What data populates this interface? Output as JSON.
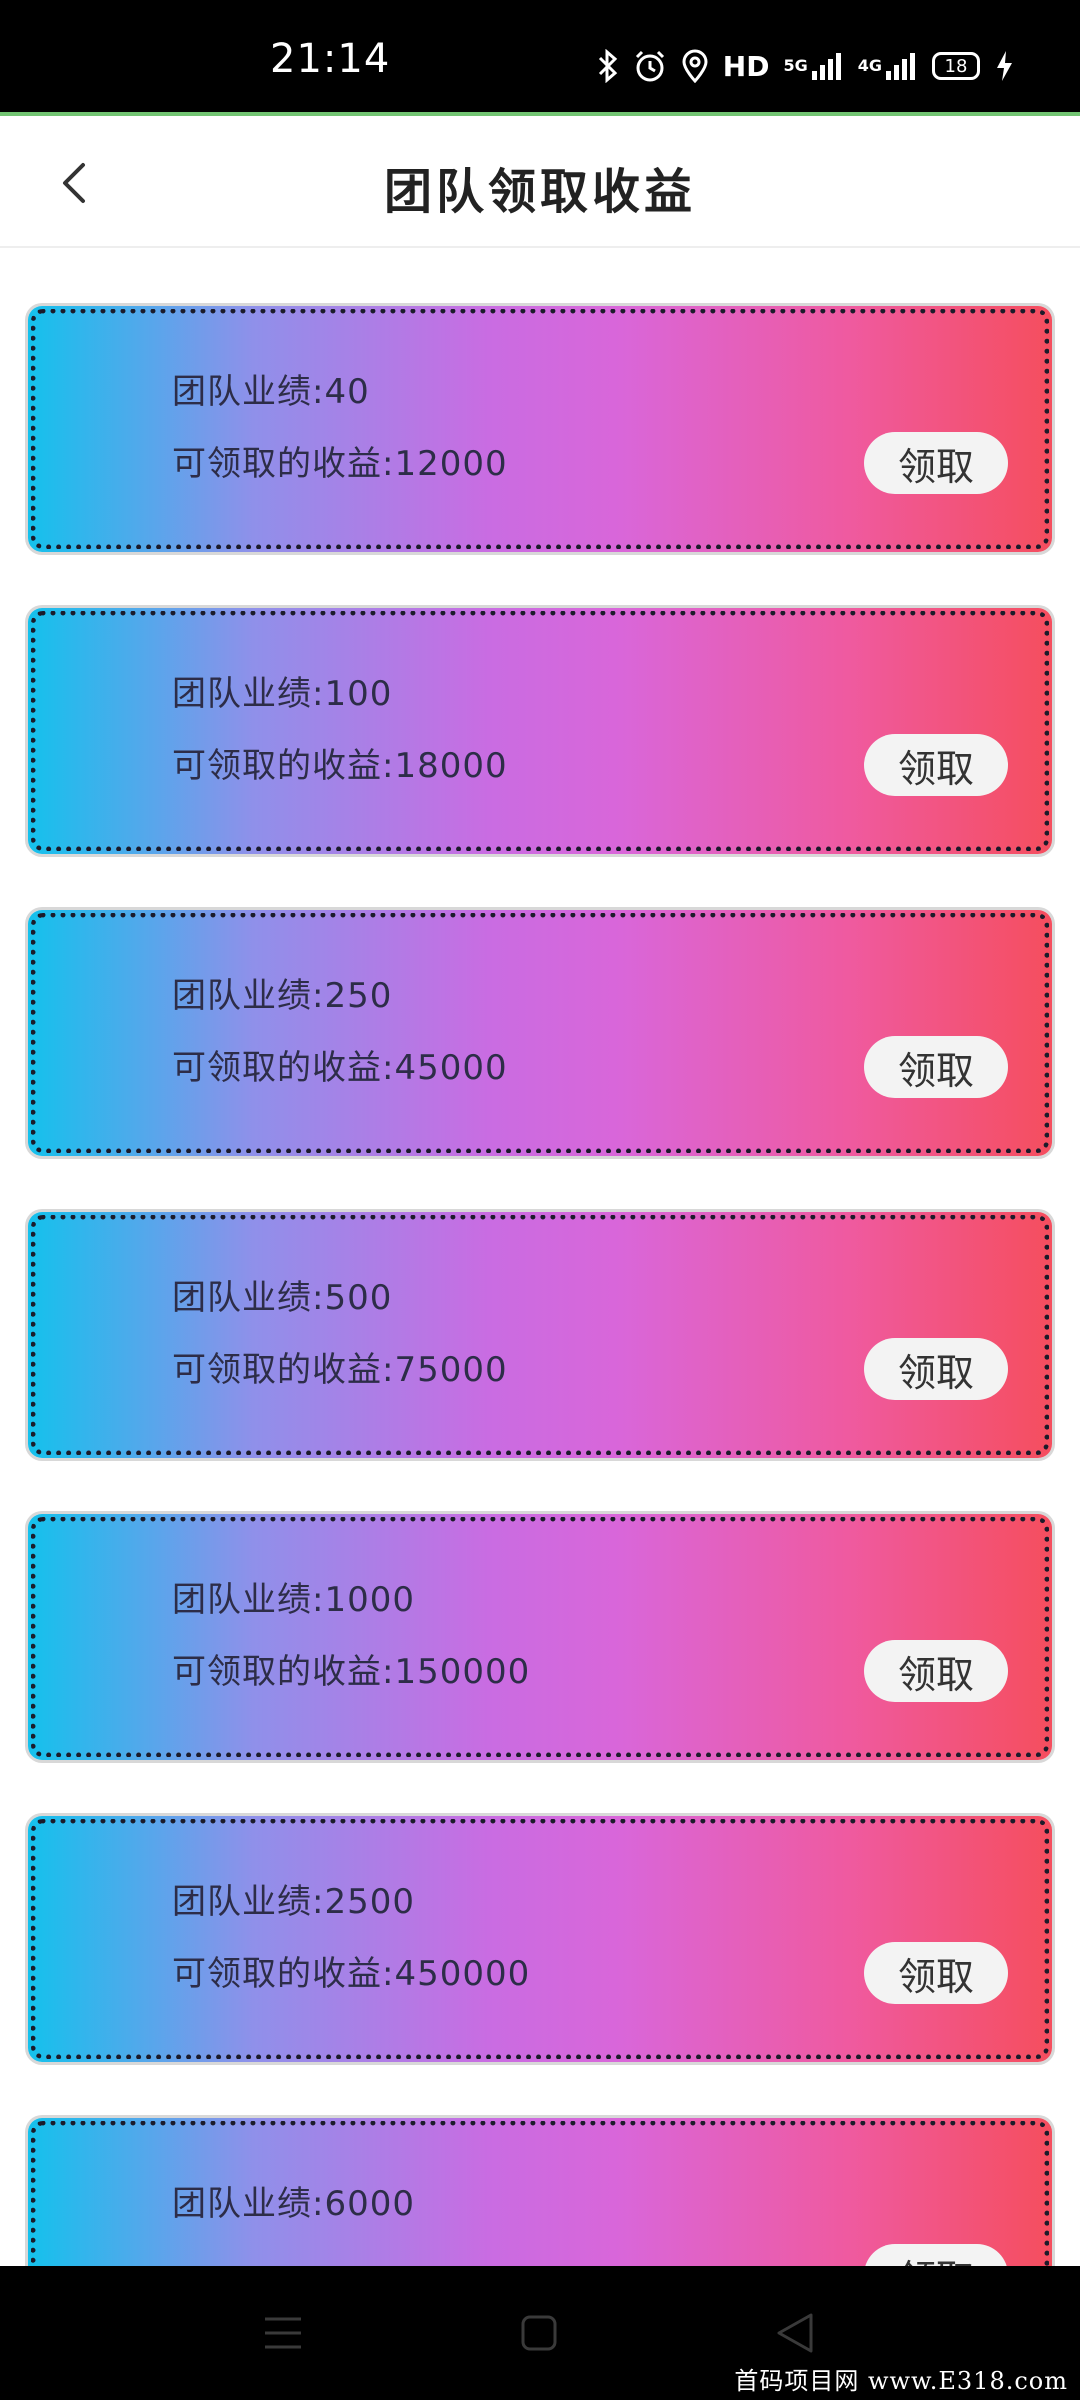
{
  "status_bar": {
    "time": "21:14",
    "network_hd": "HD",
    "network_5g": "5G",
    "network_4g": "4G",
    "battery": "18",
    "icons": [
      "bluetooth-icon",
      "alarm-icon",
      "location-icon",
      "hd-icon",
      "signal-5g-icon",
      "signal-4g-icon",
      "battery-icon",
      "charging-icon"
    ]
  },
  "header": {
    "title": "团队领取收益",
    "back_icon": "chevron-left-icon"
  },
  "cards": [
    {
      "performance": "团队业绩:40",
      "income": "可领取的收益:12000",
      "button": "领取"
    },
    {
      "performance": "团队业绩:100",
      "income": "可领取的收益:18000",
      "button": "领取"
    },
    {
      "performance": "团队业绩:250",
      "income": "可领取的收益:45000",
      "button": "领取"
    },
    {
      "performance": "团队业绩:500",
      "income": "可领取的收益:75000",
      "button": "领取"
    },
    {
      "performance": "团队业绩:1000",
      "income": "可领取的收益:150000",
      "button": "领取"
    },
    {
      "performance": "团队业绩:2500",
      "income": "可领取的收益:450000",
      "button": "领取"
    },
    {
      "performance": "团队业绩:6000",
      "income": "",
      "button": "领取"
    }
  ],
  "nav_bar": {
    "icons": [
      "menu-icon",
      "home-icon",
      "back-icon"
    ]
  },
  "watermark": "首码项目网 www.E318.com",
  "colors": {
    "gradient_start": "#14c1ec",
    "gradient_mid": "#c96ce2",
    "gradient_end": "#f54e5e",
    "accent_line": "#72c472"
  }
}
